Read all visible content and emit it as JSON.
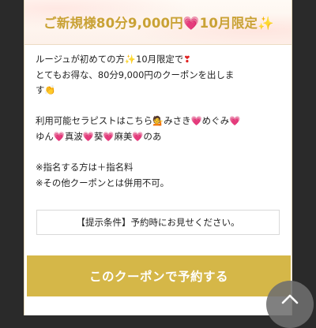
{
  "coupon": {
    "title_part1": "ご新規様80分9,000円",
    "title_heart": "💗",
    "title_part2": "10月限定",
    "title_sparkle": "✨",
    "line1_a": "ルージュが初めての方",
    "line1_sparkle": "✨",
    "line1_b": "10月限定で",
    "line1_bang": "❣",
    "line2": "とてもお得な、80分9,000円のクーポンを出しま",
    "line3_a": "す",
    "line3_emoji": "👏",
    "therapist_intro": "利用可能セラピストはこちら",
    "therapist_emoji": "💁",
    "therapists": [
      "みさき",
      "めぐみ",
      "ゆん",
      "真波",
      "葵",
      "麻美",
      "のあ"
    ],
    "heart": "💗",
    "note1": "※指名する方は＋指名料",
    "note2": "※その他クーポンとは併用不可。",
    "condition": "【提示条件】予約時にお見せください。",
    "button_label": "このクーポンで予約する"
  },
  "colors": {
    "accent_gold": "#d5b748",
    "title_gold": "#c9a235",
    "heart_pink": "#e83ea1"
  },
  "icons": {
    "scroll_top": "chevron-up-icon"
  }
}
